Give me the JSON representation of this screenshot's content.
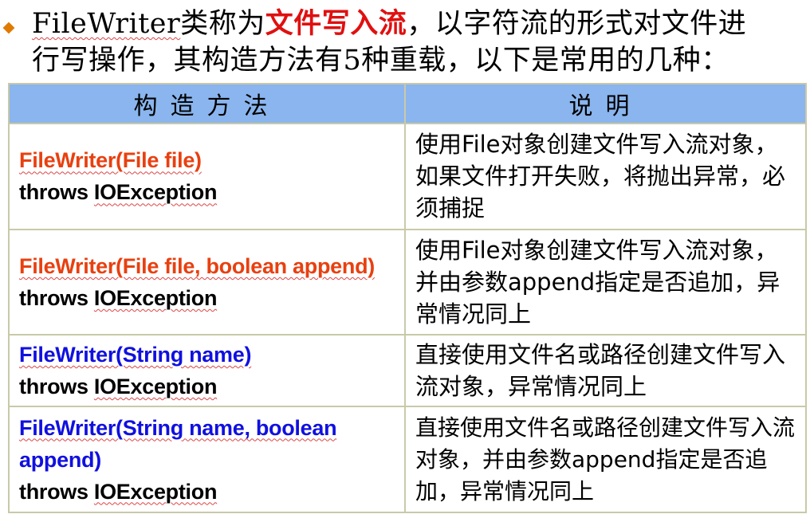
{
  "intro": {
    "line1_part1": "FileWriter",
    "line1_part2": "类称为",
    "line1_em": "文件写入流",
    "line1_part3": "，以字符流的形式对文件进",
    "line2_part1": "行写操作，其构造方法有",
    "line2_num": "5",
    "line2_part2": "种重载，以下是常用的几种："
  },
  "table": {
    "headers": [
      "构造方法",
      "说明"
    ],
    "rows": [
      {
        "ctor_line1": "FileWriter(File file)",
        "ctor_line2": "",
        "ctor_throws": "throws IOException",
        "ctor_color": "red",
        "desc": "使用File对象创建文件写入流对象，如果文件打开失败，将抛出异常，必须捕捉"
      },
      {
        "ctor_line1": "FileWriter(File file, boolean append)",
        "ctor_line2": "",
        "ctor_throws": "throws IOException",
        "ctor_color": "red",
        "desc": "使用File对象创建文件写入流对象，并由参数append指定是否追加，异常情况同上"
      },
      {
        "ctor_line1": "FileWriter(String name)",
        "ctor_line2": "",
        "ctor_throws": "throws IOException",
        "ctor_color": "blue",
        "desc": "直接使用文件名或路径创建文件写入流对象，异常情况同上"
      },
      {
        "ctor_line1": "FileWriter(String name, boolean",
        "ctor_line2": "append)",
        "ctor_throws": "throws IOException",
        "ctor_color": "blue",
        "desc": "直接使用文件名或路径创建文件写入流对象，并由参数append指定是否追加，异常情况同上"
      }
    ]
  },
  "colors": {
    "header_bg": "#8ab5ee",
    "accent_red": "#e84010",
    "accent_blue": "#1010e0",
    "emphasis_red": "#e01010",
    "bullet": "#e07a00",
    "border": "#c9c9a8"
  }
}
